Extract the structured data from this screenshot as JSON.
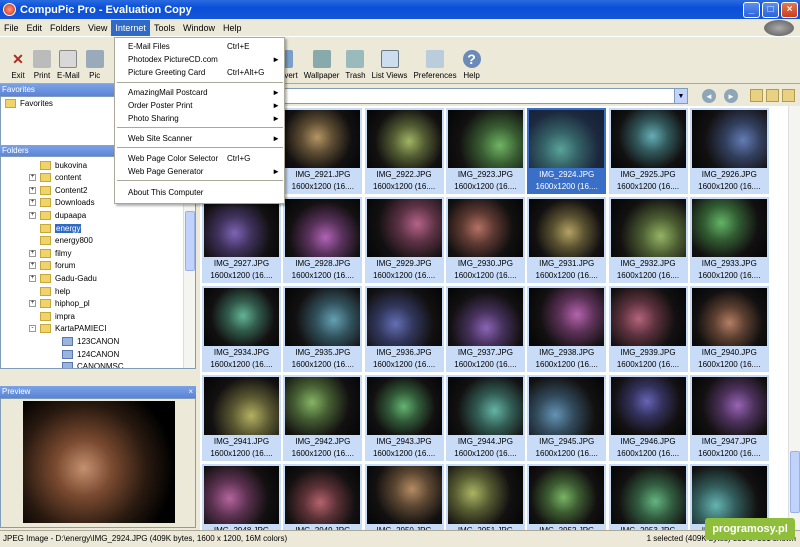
{
  "window": {
    "title": "CompuPic Pro - Evaluation Copy"
  },
  "menubar": {
    "items": [
      "File",
      "Edit",
      "Folders",
      "View",
      "Internet",
      "Tools",
      "Window",
      "Help"
    ],
    "active": "Internet"
  },
  "toolbar": {
    "items": [
      {
        "label": "Exit",
        "icon": "exit-icon"
      },
      {
        "label": "Print",
        "icon": "print-icon"
      },
      {
        "label": "E-Mail",
        "icon": "email-icon"
      },
      {
        "label": "Pic",
        "icon": "picture-icon"
      },
      {
        "label": "Convert",
        "icon": "convert-icon"
      },
      {
        "label": "Wallpaper",
        "icon": "wallpaper-icon"
      },
      {
        "label": "Trash",
        "icon": "trash-icon"
      },
      {
        "label": "List Views",
        "icon": "list-views-icon"
      },
      {
        "label": "Preferences",
        "icon": "preferences-icon"
      },
      {
        "label": "Help",
        "icon": "help-icon"
      }
    ]
  },
  "internet_menu": {
    "items": [
      {
        "label": "E-Mail Files",
        "shortcut": "Ctrl+E",
        "submenu": false
      },
      {
        "label": "Photodex PictureCD.com",
        "shortcut": "",
        "submenu": true
      },
      {
        "label": "Picture Greeting Card",
        "shortcut": "Ctrl+Alt+G",
        "submenu": false
      },
      {
        "label": "AmazingMail Postcard",
        "shortcut": "",
        "submenu": true
      },
      {
        "label": "Order Poster Print",
        "shortcut": "",
        "submenu": true
      },
      {
        "label": "Photo Sharing",
        "shortcut": "",
        "submenu": true
      },
      {
        "label": "Web Site Scanner",
        "shortcut": "",
        "submenu": true
      },
      {
        "label": "Web Page Color Selector",
        "shortcut": "Ctrl+G",
        "submenu": false
      },
      {
        "label": "Web Page Generator",
        "shortcut": "",
        "submenu": true
      },
      {
        "label": "About This Computer",
        "shortcut": "",
        "submenu": false
      }
    ]
  },
  "favorites": {
    "header": "Favorites",
    "item": "Favorites"
  },
  "folders": {
    "header": "Folders",
    "items": [
      {
        "label": "bukovina",
        "expander": ""
      },
      {
        "label": "content",
        "expander": "+"
      },
      {
        "label": "Content2",
        "expander": "+"
      },
      {
        "label": "Downloads",
        "expander": "+"
      },
      {
        "label": "dupaapa",
        "expander": "+"
      },
      {
        "label": "energy",
        "expander": "",
        "selected": true
      },
      {
        "label": "energy800",
        "expander": ""
      },
      {
        "label": "filmy",
        "expander": "+"
      },
      {
        "label": "forum",
        "expander": "+"
      },
      {
        "label": "Gadu-Gadu",
        "expander": "+"
      },
      {
        "label": "help",
        "expander": ""
      },
      {
        "label": "hiphop_pl",
        "expander": "+"
      },
      {
        "label": "impra",
        "expander": ""
      },
      {
        "label": "KartaPAMIECI",
        "expander": "-"
      },
      {
        "label": "123CANON",
        "expander": "",
        "child": true
      },
      {
        "label": "124CANON",
        "expander": "",
        "child": true
      },
      {
        "label": "CANONMSC",
        "expander": "",
        "child": true
      }
    ]
  },
  "preview": {
    "header": "Preview"
  },
  "thumbnails": [
    {
      "name": "",
      "dims": ""
    },
    {
      "name": "IMG_2921.JPG",
      "dims": "1600x1200 (16...."
    },
    {
      "name": "IMG_2922.JPG",
      "dims": "1600x1200 (16...."
    },
    {
      "name": "IMG_2923.JPG",
      "dims": "1600x1200 (16...."
    },
    {
      "name": "IMG_2924.JPG",
      "dims": "1600x1200 (16....",
      "selected": true
    },
    {
      "name": "IMG_2925.JPG",
      "dims": "1600x1200 (16...."
    },
    {
      "name": "IMG_2926.JPG",
      "dims": "1600x1200 (16...."
    },
    {
      "name": "IMG_2927.JPG",
      "dims": "1600x1200 (16...."
    },
    {
      "name": "IMG_2928.JPG",
      "dims": "1600x1200 (16...."
    },
    {
      "name": "IMG_2929.JPG",
      "dims": "1600x1200 (16...."
    },
    {
      "name": "IMG_2930.JPG",
      "dims": "1600x1200 (16...."
    },
    {
      "name": "IMG_2931.JPG",
      "dims": "1600x1200 (16...."
    },
    {
      "name": "IMG_2932.JPG",
      "dims": "1600x1200 (16...."
    },
    {
      "name": "IMG_2933.JPG",
      "dims": "1600x1200 (16...."
    },
    {
      "name": "IMG_2934.JPG",
      "dims": "1600x1200 (16...."
    },
    {
      "name": "IMG_2935.JPG",
      "dims": "1600x1200 (16...."
    },
    {
      "name": "IMG_2936.JPG",
      "dims": "1600x1200 (16...."
    },
    {
      "name": "IMG_2937.JPG",
      "dims": "1600x1200 (16...."
    },
    {
      "name": "IMG_2938.JPG",
      "dims": "1600x1200 (16...."
    },
    {
      "name": "IMG_2939.JPG",
      "dims": "1600x1200 (16...."
    },
    {
      "name": "IMG_2940.JPG",
      "dims": "1600x1200 (16...."
    },
    {
      "name": "IMG_2941.JPG",
      "dims": "1600x1200 (16...."
    },
    {
      "name": "IMG_2942.JPG",
      "dims": "1600x1200 (16...."
    },
    {
      "name": "IMG_2943.JPG",
      "dims": "1600x1200 (16...."
    },
    {
      "name": "IMG_2944.JPG",
      "dims": "1600x1200 (16...."
    },
    {
      "name": "IMG_2945.JPG",
      "dims": "1600x1200 (16...."
    },
    {
      "name": "IMG_2946.JPG",
      "dims": "1600x1200 (16...."
    },
    {
      "name": "IMG_2947.JPG",
      "dims": "1600x1200 (16...."
    },
    {
      "name": "IMG_2948.JPG",
      "dims": ""
    },
    {
      "name": "IMG_2949.JPG",
      "dims": ""
    },
    {
      "name": "IMG_2950.JPG",
      "dims": ""
    },
    {
      "name": "IMG_2951.JPG",
      "dims": ""
    },
    {
      "name": "IMG_2952.JPG",
      "dims": ""
    },
    {
      "name": "IMG_2953.JPG",
      "dims": ""
    },
    {
      "name": "IMG_2954.JPG",
      "dims": ""
    }
  ],
  "status": {
    "left": "JPEG Image - D:\\energy\\IMG_2924.JPG  (409K bytes, 1600 x 1200, 16M colors)",
    "right": "1 selected (409K bytes)  331 of 331 shown"
  },
  "watermark": "programosy.pl",
  "colors": {
    "title_bar": "#0a4fd8",
    "selection": "#316ac5",
    "thumb_bg": "#c8dcf8"
  }
}
